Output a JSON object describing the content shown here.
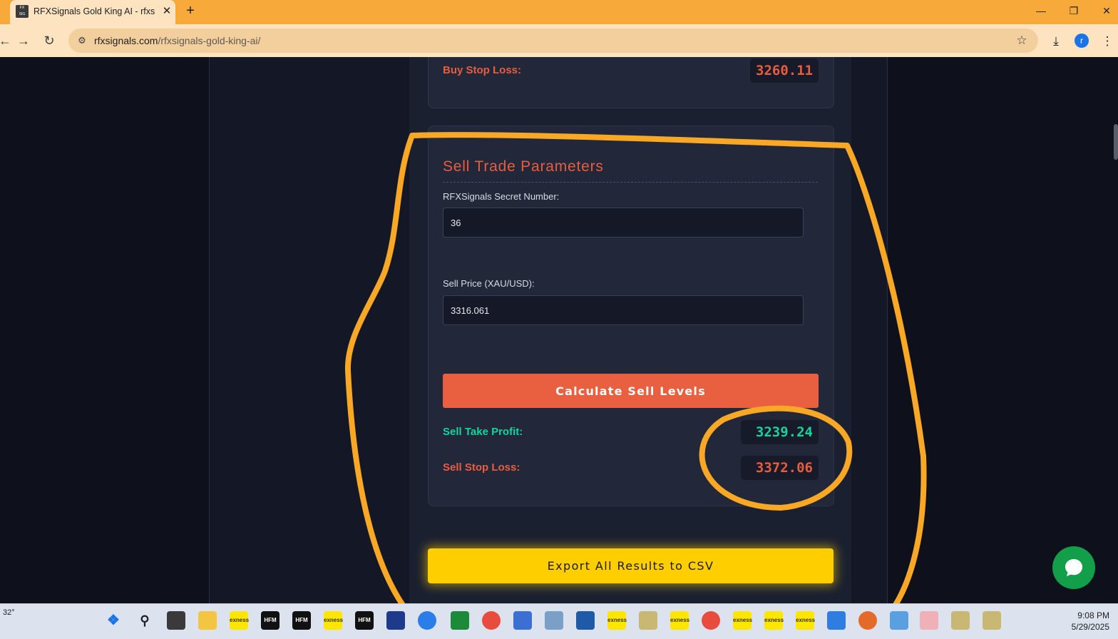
{
  "browser": {
    "tab_title": "RFXSignals Gold King AI - rfxsig",
    "tab_close": "✕",
    "new_tab": "+",
    "url_domain": "rfxsignals.com",
    "url_path": "/rfxsignals-gold-king-ai/",
    "profile_initial": "r"
  },
  "buy_section": {
    "stop_loss_label": "Buy Stop Loss:",
    "stop_loss_value": "3260.11"
  },
  "sell_section": {
    "title": "Sell Trade Parameters",
    "secret_label": "RFXSignals Secret Number:",
    "secret_value": "36",
    "price_label": "Sell Price (XAU/USD):",
    "price_value": "3316.061",
    "calculate_label": "Calculate Sell Levels",
    "take_profit_label": "Sell Take Profit:",
    "take_profit_value": "3239.24",
    "stop_loss_label": "Sell Stop Loss:",
    "stop_loss_value": "3372.06"
  },
  "export_label": "Export All Results to CSV",
  "taskbar": {
    "weather": "32°",
    "time": "9:08 PM",
    "date": "5/29/2025",
    "app_labels": {
      "hfm": "HFM",
      "exness": "exness"
    }
  },
  "colors": {
    "accent_red": "#e85d3f",
    "accent_green": "#18d39e",
    "export_yellow": "#ffce00",
    "annotation_orange": "#f9a825"
  }
}
